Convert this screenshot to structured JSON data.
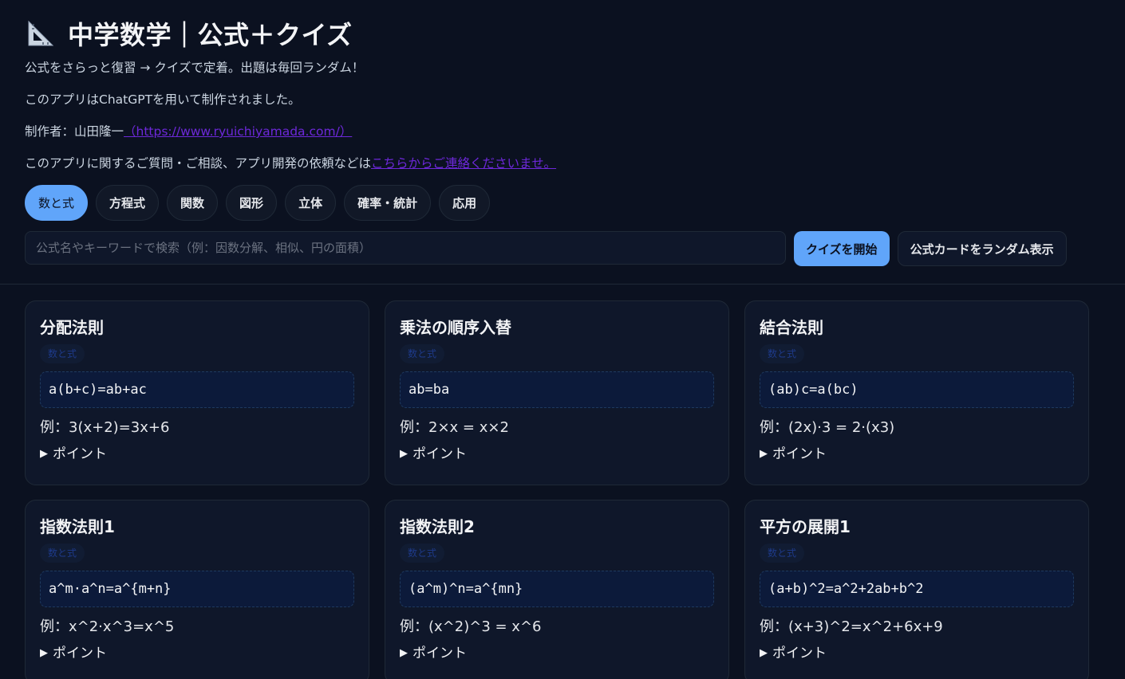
{
  "header": {
    "icon": "triangle-ruler-icon",
    "title": "中学数学｜公式＋クイズ",
    "subtitle": "公式をさらっと復習 → クイズで定着。出題は毎回ランダム！",
    "credit": "このアプリはChatGPTを用いて制作されました。",
    "author_prefix": "制作者：山田隆一",
    "author_link": "（https://www.ryuichiyamada.com/）",
    "contact_prefix": "このアプリに関するご質問・ご相談、アプリ開発の依頼などは",
    "contact_link": "こちらからご連絡くださいませ。"
  },
  "tabs": [
    "数と式",
    "方程式",
    "関数",
    "図形",
    "立体",
    "確率・統計",
    "応用"
  ],
  "active_tab": 0,
  "search": {
    "placeholder": "公式名やキーワードで検索（例：因数分解、相似、円の面積）",
    "value": ""
  },
  "buttons": {
    "start_quiz": "クイズを開始",
    "random_card": "公式カードをランダム表示"
  },
  "cards": [
    {
      "title": "分配法則",
      "tag": "数と式",
      "formula": "a(b+c)=ab+ac",
      "example": "例：3(x+2)=3x+6",
      "point": "ポイント"
    },
    {
      "title": "乗法の順序入替",
      "tag": "数と式",
      "formula": "ab=ba",
      "example": "例：2×x = x×2",
      "point": "ポイント"
    },
    {
      "title": "結合法則",
      "tag": "数と式",
      "formula": "(ab)c=a(bc)",
      "example": "例：(2x)·3 = 2·(x3)",
      "point": "ポイント"
    },
    {
      "title": "指数法則1",
      "tag": "数と式",
      "formula": "a^m·a^n=a^{m+n}",
      "example": "例：x^2·x^3=x^5",
      "point": "ポイント"
    },
    {
      "title": "指数法則2",
      "tag": "数と式",
      "formula": "(a^m)^n=a^{mn}",
      "example": "例：(x^2)^3 = x^6",
      "point": "ポイント"
    },
    {
      "title": "平方の展開1",
      "tag": "数と式",
      "formula": "(a+b)^2=a^2+2ab+b^2",
      "example": "例：(x+3)^2=x^2+6x+9",
      "point": "ポイント"
    }
  ],
  "colors": {
    "background": "#0b1120",
    "accent": "#60a5fa",
    "link": "#6d28d9",
    "card": "#0f172a"
  }
}
